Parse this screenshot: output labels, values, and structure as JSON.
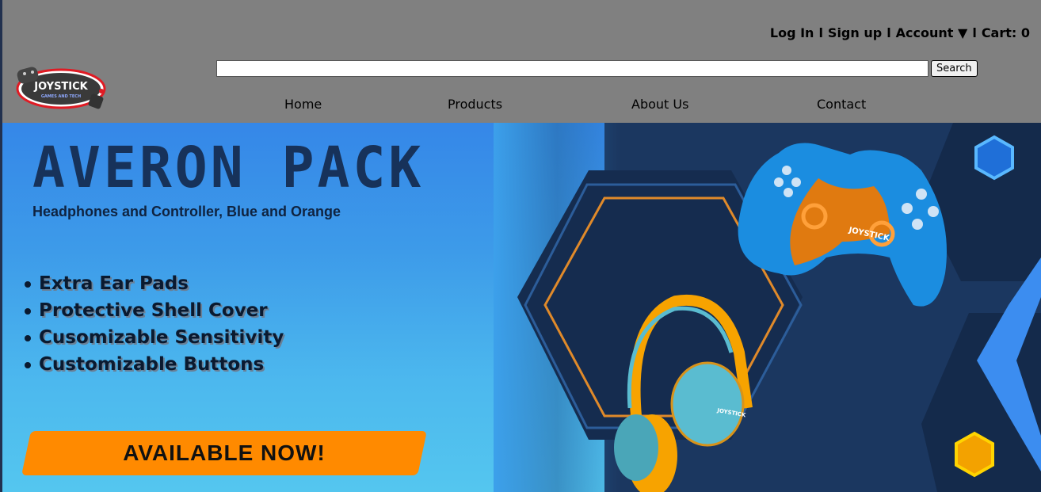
{
  "header": {
    "account_links": [
      "Log In",
      "Sign up",
      "Account ▼",
      "Cart: 0"
    ],
    "separator": "l",
    "logo": {
      "name": "JOYSTICK",
      "tagline": "GAMES AND TECH"
    },
    "search": {
      "value": "",
      "button_label": "Search"
    },
    "nav": [
      "Home",
      "Products",
      "About Us",
      "Contact"
    ]
  },
  "banner": {
    "title": "AVERON PACK",
    "subtitle": "Headphones and Controller, Blue and Orange",
    "features": [
      "Extra Ear  Pads",
      "Protective Shell Cover",
      "Cusomizable Sensitivity",
      "Customizable Buttons"
    ],
    "cta_label": "AVAILABLE NOW!",
    "product_brand": "JOYSTICK"
  },
  "colors": {
    "header_bg": "#808080",
    "banner_blue": "#3d9be9",
    "navy": "#17325a",
    "accent_orange": "#ff8a00"
  }
}
